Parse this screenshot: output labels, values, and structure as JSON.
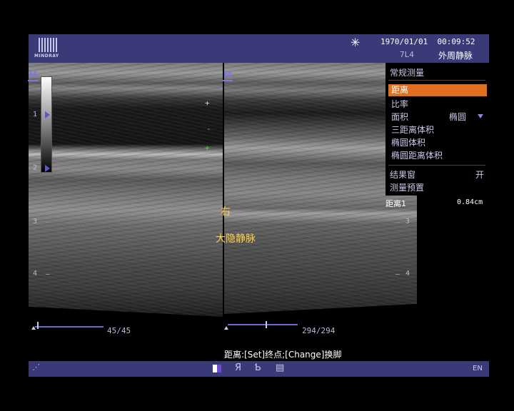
{
  "header": {
    "brand": "MINDRAY",
    "datetime": "1970/01/01  00:09:52",
    "probe": "7L4",
    "exam": "外周静脉",
    "freeze_icon": "snowflake-icon"
  },
  "image": {
    "depth_labels_left": [
      "1",
      "2",
      "3",
      "4"
    ],
    "depth_labels_right": [
      "3",
      "4"
    ],
    "annotation_side": "右",
    "annotation_vessel": "大隐静脉",
    "caliper_marker": "+",
    "caliper_dash": "-",
    "caliper_active": "+"
  },
  "menu": {
    "title": "常规测量",
    "items": [
      {
        "label": "距离",
        "selected": true
      },
      {
        "label": "比率"
      },
      {
        "label": "面积"
      },
      {
        "label": "三距离体积"
      },
      {
        "label": "椭圆体积"
      },
      {
        "label": "椭圆距离体积"
      }
    ],
    "area_method": "椭圆",
    "result_window_label": "结果窗",
    "result_window_state": "开",
    "preset_label": "测量预置"
  },
  "results": {
    "label": "距离1",
    "value": "0.84cm"
  },
  "cine": {
    "left_counter": "45/45",
    "right_counter": "294/294",
    "left_position": 1.0,
    "right_position": 1.0
  },
  "prompt": "距离:[Set]终点;[Change]换脚",
  "bottombar": {
    "language": "EN",
    "icons": [
      "cursor-icon",
      "dual-image-icon",
      "r-letter-icon",
      "b-letter-icon",
      "report-icon"
    ]
  },
  "colors": {
    "panel_bg": "#3a3a78",
    "selected_item": "#e07020",
    "annotation": "#ffd24a"
  }
}
